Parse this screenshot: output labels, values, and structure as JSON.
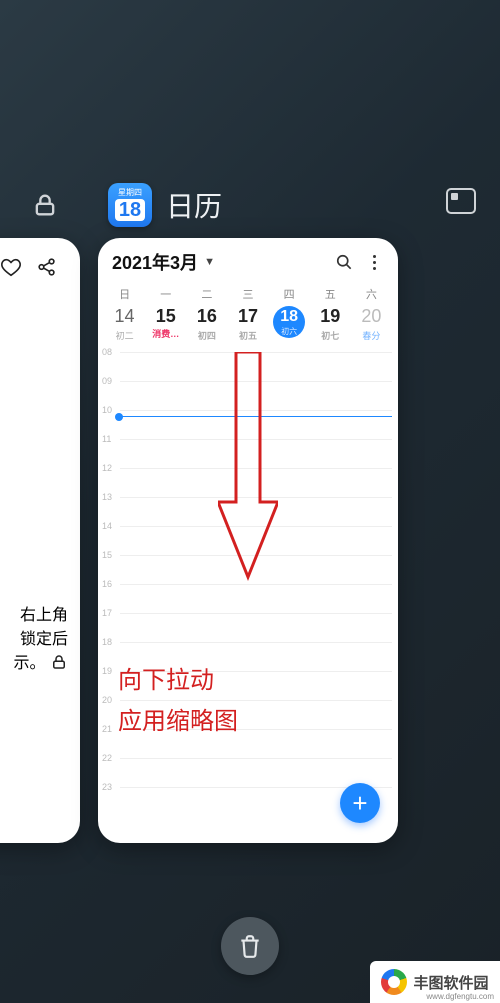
{
  "topbar": {
    "app_icon_weekday": "星期四",
    "app_icon_day": "18",
    "app_title": "日历"
  },
  "left_card": {
    "line1": "右上角",
    "line2": "锁定后",
    "line3_prefix": "示。"
  },
  "calendar": {
    "month_label": "2021年3月",
    "weekdays": [
      "日",
      "一",
      "二",
      "三",
      "四",
      "五",
      "六"
    ],
    "days": [
      {
        "num": "14",
        "sub": "初二"
      },
      {
        "num": "15",
        "sub": "消费…",
        "dark": true,
        "red": true
      },
      {
        "num": "16",
        "sub": "初四",
        "dark": true
      },
      {
        "num": "17",
        "sub": "初五",
        "dark": true
      },
      {
        "num": "18",
        "sub": "初六",
        "today": true
      },
      {
        "num": "19",
        "sub": "初七",
        "dark": true
      },
      {
        "num": "20",
        "sub": "春分",
        "last": true
      }
    ],
    "hours": [
      "08",
      "09",
      "10",
      "11",
      "12",
      "13",
      "14",
      "15",
      "16",
      "17",
      "18",
      "19",
      "20",
      "21",
      "22",
      "23"
    ],
    "fab_label": "+"
  },
  "annotation": {
    "line1": "向下拉动",
    "line2": "应用缩略图"
  },
  "watermark": {
    "name": "丰图软件园",
    "url": "www.dgfengtu.com"
  }
}
